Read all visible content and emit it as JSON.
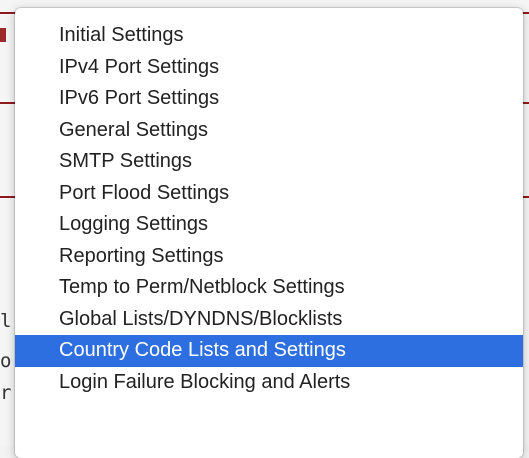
{
  "background": {
    "fragments": [
      "l",
      "o",
      "r"
    ],
    "accent_color": "#8e1b1b"
  },
  "dropdown": {
    "selected_index": 10,
    "selection_color": "#2d6fe0",
    "items": [
      {
        "label": "Initial Settings"
      },
      {
        "label": "IPv4 Port Settings"
      },
      {
        "label": "IPv6 Port Settings"
      },
      {
        "label": "General Settings"
      },
      {
        "label": "SMTP Settings"
      },
      {
        "label": "Port Flood Settings"
      },
      {
        "label": "Logging Settings"
      },
      {
        "label": "Reporting Settings"
      },
      {
        "label": "Temp to Perm/Netblock Settings"
      },
      {
        "label": "Global Lists/DYNDNS/Blocklists"
      },
      {
        "label": "Country Code Lists and Settings"
      },
      {
        "label": "Login Failure Blocking and Alerts"
      }
    ]
  }
}
